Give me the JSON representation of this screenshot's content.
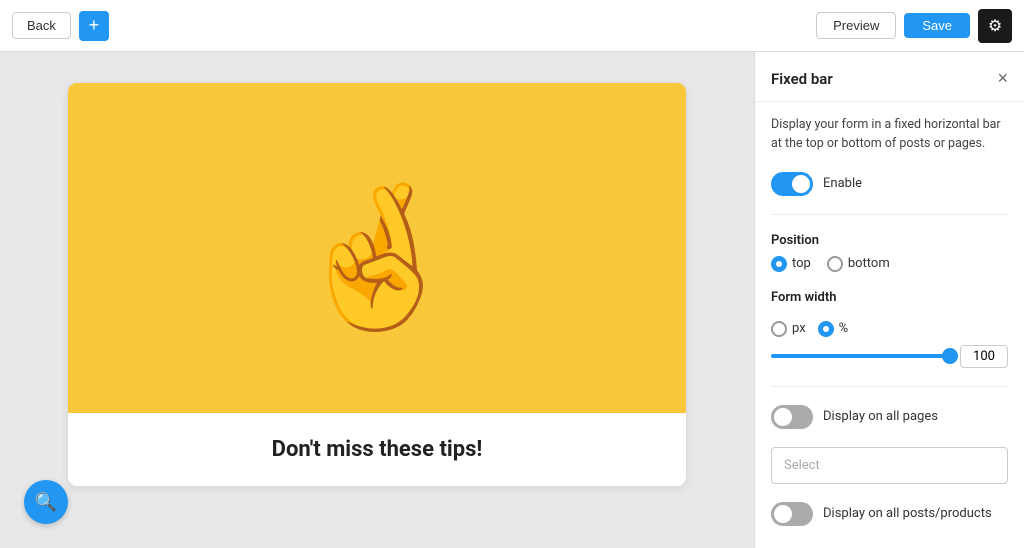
{
  "toolbar": {
    "back_label": "Back",
    "plus_label": "+",
    "preview_label": "Preview",
    "save_label": "Save",
    "gear_icon": "⚙"
  },
  "canvas": {
    "card": {
      "emoji": "🤞",
      "title": "Don't miss these tips!"
    }
  },
  "panel": {
    "title": "Fixed bar",
    "close_icon": "×",
    "description": "Display your form in a fixed horizontal bar at the top or bottom of posts or pages.",
    "enable_label": "Enable",
    "enable_on": true,
    "position": {
      "label": "Position",
      "options": [
        "top",
        "bottom"
      ],
      "selected": "top"
    },
    "form_width": {
      "label": "Form width",
      "unit_options": [
        "px",
        "%"
      ],
      "selected_unit": "%",
      "value": "100"
    },
    "display_all_pages": {
      "label": "Display on all pages",
      "enabled": false
    },
    "select_placeholder": "Select",
    "display_all_posts": {
      "label": "Display on all posts/products",
      "enabled": true
    }
  }
}
